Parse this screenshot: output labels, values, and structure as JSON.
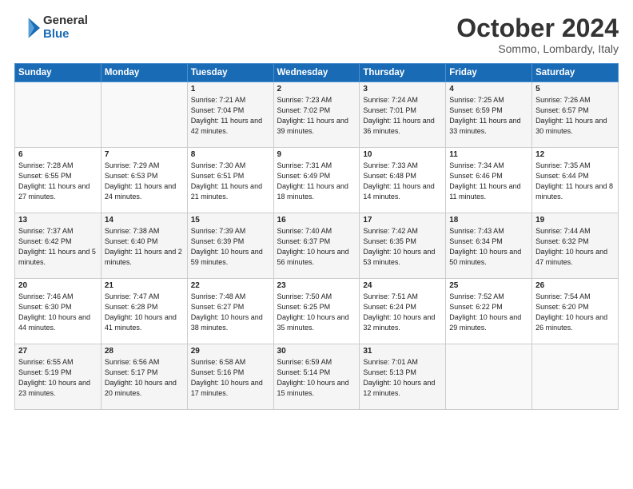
{
  "header": {
    "logo_general": "General",
    "logo_blue": "Blue",
    "month_title": "October 2024",
    "location": "Sommo, Lombardy, Italy"
  },
  "weekdays": [
    "Sunday",
    "Monday",
    "Tuesday",
    "Wednesday",
    "Thursday",
    "Friday",
    "Saturday"
  ],
  "weeks": [
    [
      {
        "day": "",
        "sunrise": "",
        "sunset": "",
        "daylight": ""
      },
      {
        "day": "",
        "sunrise": "",
        "sunset": "",
        "daylight": ""
      },
      {
        "day": "1",
        "sunrise": "Sunrise: 7:21 AM",
        "sunset": "Sunset: 7:04 PM",
        "daylight": "Daylight: 11 hours and 42 minutes."
      },
      {
        "day": "2",
        "sunrise": "Sunrise: 7:23 AM",
        "sunset": "Sunset: 7:02 PM",
        "daylight": "Daylight: 11 hours and 39 minutes."
      },
      {
        "day": "3",
        "sunrise": "Sunrise: 7:24 AM",
        "sunset": "Sunset: 7:01 PM",
        "daylight": "Daylight: 11 hours and 36 minutes."
      },
      {
        "day": "4",
        "sunrise": "Sunrise: 7:25 AM",
        "sunset": "Sunset: 6:59 PM",
        "daylight": "Daylight: 11 hours and 33 minutes."
      },
      {
        "day": "5",
        "sunrise": "Sunrise: 7:26 AM",
        "sunset": "Sunset: 6:57 PM",
        "daylight": "Daylight: 11 hours and 30 minutes."
      }
    ],
    [
      {
        "day": "6",
        "sunrise": "Sunrise: 7:28 AM",
        "sunset": "Sunset: 6:55 PM",
        "daylight": "Daylight: 11 hours and 27 minutes."
      },
      {
        "day": "7",
        "sunrise": "Sunrise: 7:29 AM",
        "sunset": "Sunset: 6:53 PM",
        "daylight": "Daylight: 11 hours and 24 minutes."
      },
      {
        "day": "8",
        "sunrise": "Sunrise: 7:30 AM",
        "sunset": "Sunset: 6:51 PM",
        "daylight": "Daylight: 11 hours and 21 minutes."
      },
      {
        "day": "9",
        "sunrise": "Sunrise: 7:31 AM",
        "sunset": "Sunset: 6:49 PM",
        "daylight": "Daylight: 11 hours and 18 minutes."
      },
      {
        "day": "10",
        "sunrise": "Sunrise: 7:33 AM",
        "sunset": "Sunset: 6:48 PM",
        "daylight": "Daylight: 11 hours and 14 minutes."
      },
      {
        "day": "11",
        "sunrise": "Sunrise: 7:34 AM",
        "sunset": "Sunset: 6:46 PM",
        "daylight": "Daylight: 11 hours and 11 minutes."
      },
      {
        "day": "12",
        "sunrise": "Sunrise: 7:35 AM",
        "sunset": "Sunset: 6:44 PM",
        "daylight": "Daylight: 11 hours and 8 minutes."
      }
    ],
    [
      {
        "day": "13",
        "sunrise": "Sunrise: 7:37 AM",
        "sunset": "Sunset: 6:42 PM",
        "daylight": "Daylight: 11 hours and 5 minutes."
      },
      {
        "day": "14",
        "sunrise": "Sunrise: 7:38 AM",
        "sunset": "Sunset: 6:40 PM",
        "daylight": "Daylight: 11 hours and 2 minutes."
      },
      {
        "day": "15",
        "sunrise": "Sunrise: 7:39 AM",
        "sunset": "Sunset: 6:39 PM",
        "daylight": "Daylight: 10 hours and 59 minutes."
      },
      {
        "day": "16",
        "sunrise": "Sunrise: 7:40 AM",
        "sunset": "Sunset: 6:37 PM",
        "daylight": "Daylight: 10 hours and 56 minutes."
      },
      {
        "day": "17",
        "sunrise": "Sunrise: 7:42 AM",
        "sunset": "Sunset: 6:35 PM",
        "daylight": "Daylight: 10 hours and 53 minutes."
      },
      {
        "day": "18",
        "sunrise": "Sunrise: 7:43 AM",
        "sunset": "Sunset: 6:34 PM",
        "daylight": "Daylight: 10 hours and 50 minutes."
      },
      {
        "day": "19",
        "sunrise": "Sunrise: 7:44 AM",
        "sunset": "Sunset: 6:32 PM",
        "daylight": "Daylight: 10 hours and 47 minutes."
      }
    ],
    [
      {
        "day": "20",
        "sunrise": "Sunrise: 7:46 AM",
        "sunset": "Sunset: 6:30 PM",
        "daylight": "Daylight: 10 hours and 44 minutes."
      },
      {
        "day": "21",
        "sunrise": "Sunrise: 7:47 AM",
        "sunset": "Sunset: 6:28 PM",
        "daylight": "Daylight: 10 hours and 41 minutes."
      },
      {
        "day": "22",
        "sunrise": "Sunrise: 7:48 AM",
        "sunset": "Sunset: 6:27 PM",
        "daylight": "Daylight: 10 hours and 38 minutes."
      },
      {
        "day": "23",
        "sunrise": "Sunrise: 7:50 AM",
        "sunset": "Sunset: 6:25 PM",
        "daylight": "Daylight: 10 hours and 35 minutes."
      },
      {
        "day": "24",
        "sunrise": "Sunrise: 7:51 AM",
        "sunset": "Sunset: 6:24 PM",
        "daylight": "Daylight: 10 hours and 32 minutes."
      },
      {
        "day": "25",
        "sunrise": "Sunrise: 7:52 AM",
        "sunset": "Sunset: 6:22 PM",
        "daylight": "Daylight: 10 hours and 29 minutes."
      },
      {
        "day": "26",
        "sunrise": "Sunrise: 7:54 AM",
        "sunset": "Sunset: 6:20 PM",
        "daylight": "Daylight: 10 hours and 26 minutes."
      }
    ],
    [
      {
        "day": "27",
        "sunrise": "Sunrise: 6:55 AM",
        "sunset": "Sunset: 5:19 PM",
        "daylight": "Daylight: 10 hours and 23 minutes."
      },
      {
        "day": "28",
        "sunrise": "Sunrise: 6:56 AM",
        "sunset": "Sunset: 5:17 PM",
        "daylight": "Daylight: 10 hours and 20 minutes."
      },
      {
        "day": "29",
        "sunrise": "Sunrise: 6:58 AM",
        "sunset": "Sunset: 5:16 PM",
        "daylight": "Daylight: 10 hours and 17 minutes."
      },
      {
        "day": "30",
        "sunrise": "Sunrise: 6:59 AM",
        "sunset": "Sunset: 5:14 PM",
        "daylight": "Daylight: 10 hours and 15 minutes."
      },
      {
        "day": "31",
        "sunrise": "Sunrise: 7:01 AM",
        "sunset": "Sunset: 5:13 PM",
        "daylight": "Daylight: 10 hours and 12 minutes."
      },
      {
        "day": "",
        "sunrise": "",
        "sunset": "",
        "daylight": ""
      },
      {
        "day": "",
        "sunrise": "",
        "sunset": "",
        "daylight": ""
      }
    ]
  ]
}
